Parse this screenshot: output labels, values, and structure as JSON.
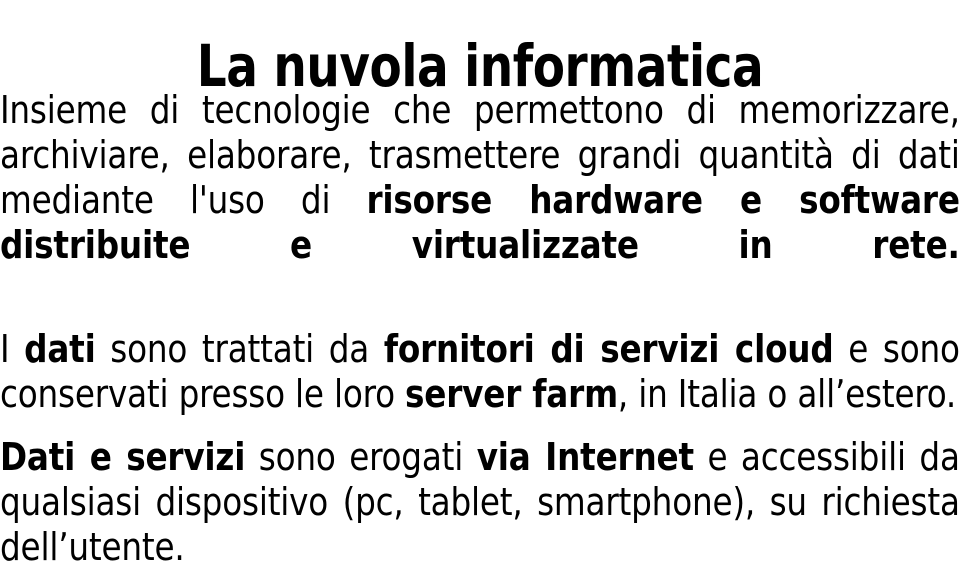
{
  "slide": {
    "title": "La nuvola informatica",
    "background_color": "#ffffff",
    "text_color": "#000000",
    "paragraphs": [
      {
        "id": "definizione",
        "plain_text": "Insieme di tecnologie che permettono di memorizzare, archiviare, elaborare, trasmettere grandi quantità di dati mediante l'uso di risorse hardware e software distribuite e virtualizzate in rete.",
        "runs": [
          {
            "text": "Insieme di tecnologie che permettono di memorizzare, archiviare, elaborare, trasmettere grandi quantità di dati mediante l'uso di ",
            "bold": false
          },
          {
            "text": "risorse hardware e software distribuite e virtualizzate in rete.",
            "bold": true
          }
        ]
      },
      {
        "id": "trattamento-dati",
        "plain_text": "I dati sono trattati da fornitori di servizi cloud e sono conservati presso le loro server farm, in Italia o all’estero.",
        "runs": [
          {
            "text": "I ",
            "bold": false
          },
          {
            "text": "dati",
            "bold": true
          },
          {
            "text": " sono trattati da ",
            "bold": false
          },
          {
            "text": "fornitori di servizi cloud",
            "bold": true
          },
          {
            "text": " e sono conservati presso le loro ",
            "bold": false
          },
          {
            "text": "server farm",
            "bold": true
          },
          {
            "text": ", in Italia o all’estero.",
            "bold": false
          }
        ]
      },
      {
        "id": "erogazione",
        "plain_text": "Dati e servizi sono erogati via Internet e accessibili da qualsiasi dispositivo (pc, tablet, smartphone), su richiesta dell’utente.",
        "runs": [
          {
            "text": "Dati e servizi",
            "bold": true
          },
          {
            "text": " sono erogati ",
            "bold": false
          },
          {
            "text": "via Internet",
            "bold": true
          },
          {
            "text": " e accessibili da qualsiasi dispositivo (pc, tablet, smartphone), su richiesta dell’utente.",
            "bold": false
          }
        ]
      }
    ]
  }
}
